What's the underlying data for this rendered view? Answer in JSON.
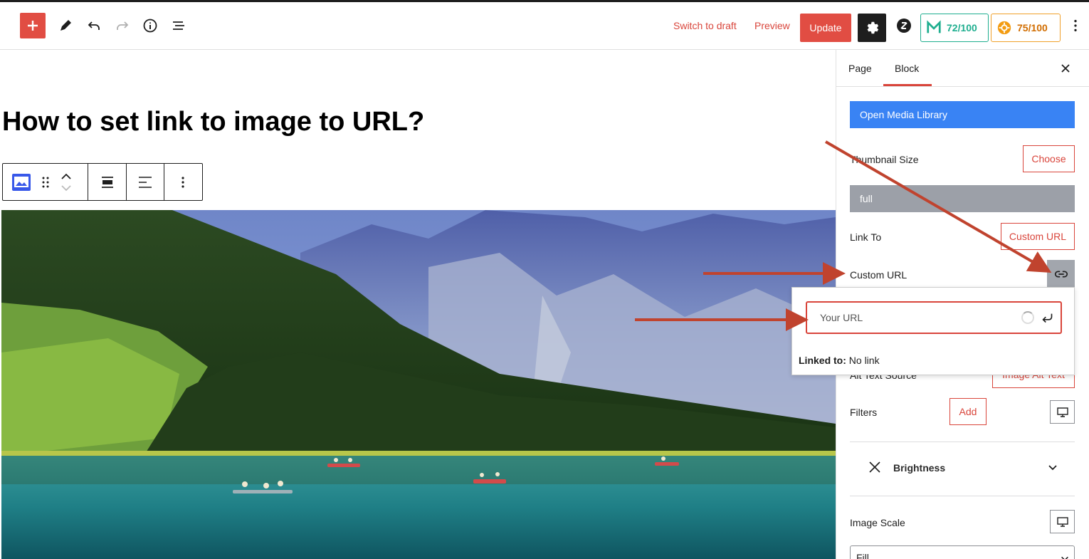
{
  "toolbar": {
    "switch_to_draft": "Switch to draft",
    "preview": "Preview",
    "update": "Update",
    "score_seo": "72/100",
    "score_readability": "75/100",
    "icons": [
      "plus-icon",
      "pencil-icon",
      "undo-icon",
      "redo-icon",
      "info-icon",
      "list-view-icon",
      "gear-icon",
      "brand-icon",
      "more-vertical-icon"
    ]
  },
  "editor": {
    "post_title": "How to set link to image to URL?"
  },
  "sidebar": {
    "tabs": {
      "page": "Page",
      "block": "Block"
    },
    "open_media_library": "Open Media Library",
    "thumbnail_size_label": "Thumbnail Size",
    "choose": "Choose",
    "size_value": "full",
    "link_to_label": "Link To",
    "link_to_value": "Custom URL",
    "custom_url_label": "Custom URL",
    "alt_text_source_label": "Alt Text Source",
    "alt_text_source_value": "Image Alt Text",
    "filters_label": "Filters",
    "add": "Add",
    "brightness_label": "Brightness",
    "image_scale_label": "Image Scale",
    "image_scale_value": "Fill"
  },
  "popover": {
    "url_placeholder": "Your URL",
    "linked_to_label": "Linked to:",
    "linked_to_value": "No link"
  },
  "colors": {
    "accent": "#e14d43",
    "media_button": "#3983f4",
    "annotation_arrow": "#c0432e"
  }
}
